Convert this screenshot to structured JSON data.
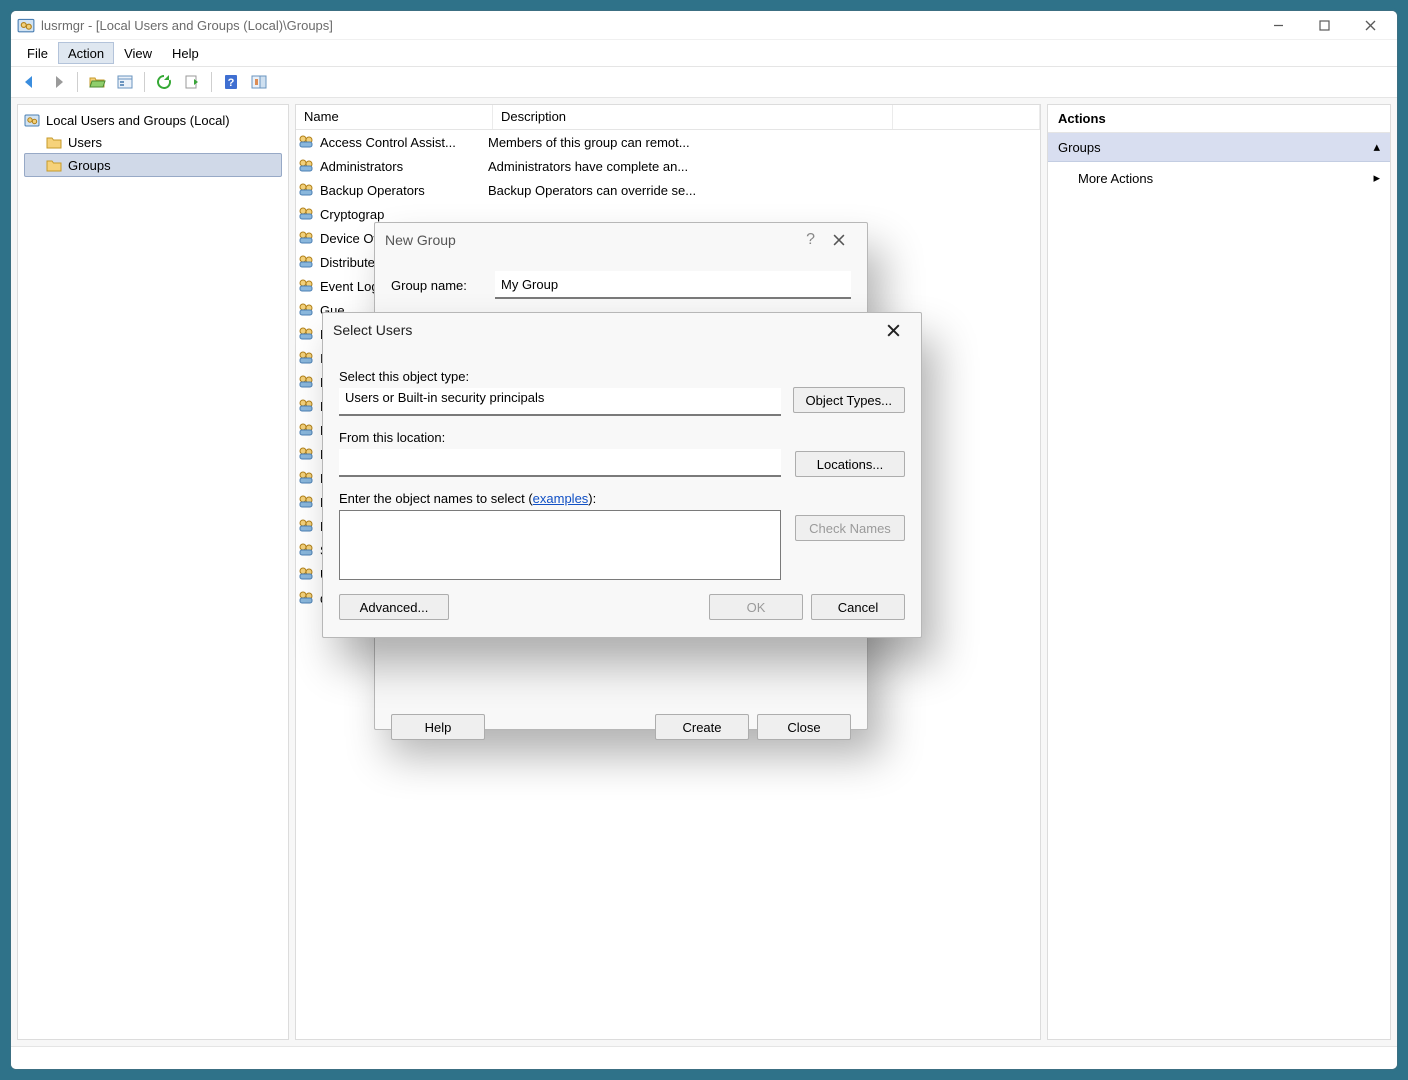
{
  "window": {
    "title": "lusrmgr - [Local Users and Groups (Local)\\Groups]"
  },
  "menus": [
    "File",
    "Action",
    "View",
    "Help"
  ],
  "active_menu_index": 1,
  "tree": {
    "root": "Local Users and Groups (Local)",
    "children": [
      "Users",
      "Groups"
    ],
    "selected_index": 1
  },
  "list": {
    "columns": [
      "Name",
      "Description"
    ],
    "rows": [
      {
        "name": "Access Control Assist...",
        "desc": "Members of this group can remot..."
      },
      {
        "name": "Administrators",
        "desc": "Administrators have complete an..."
      },
      {
        "name": "Backup Operators",
        "desc": "Backup Operators can override se..."
      },
      {
        "name": "Cryptograp",
        "desc": ""
      },
      {
        "name": "Device Own",
        "desc": ""
      },
      {
        "name": "Distributed",
        "desc": ""
      },
      {
        "name": "Event Log R",
        "desc": ""
      },
      {
        "name": "Gue",
        "desc": ""
      },
      {
        "name": "Hyp",
        "desc": ""
      },
      {
        "name": "IIS_I",
        "desc": ""
      },
      {
        "name": "Netv",
        "desc": ""
      },
      {
        "name": "Perf",
        "desc": ""
      },
      {
        "name": "Perf",
        "desc": ""
      },
      {
        "name": "Pow",
        "desc": ""
      },
      {
        "name": "Rem",
        "desc": ""
      },
      {
        "name": "Rem",
        "desc": ""
      },
      {
        "name": "Repl",
        "desc": ""
      },
      {
        "name": "Syst",
        "desc": ""
      },
      {
        "name": "User",
        "desc": ""
      },
      {
        "name": "dock",
        "desc": ""
      }
    ]
  },
  "actions": {
    "title": "Actions",
    "section": "Groups",
    "items": [
      "More Actions"
    ]
  },
  "new_group": {
    "title": "New Group",
    "group_name_label": "Group name:",
    "group_name_value": "My Group",
    "help_btn": "Help",
    "create_btn": "Create",
    "close_btn": "Close"
  },
  "select_users": {
    "title": "Select Users",
    "object_type_label": "Select this object type:",
    "object_type_value": "Users or Built-in security principals",
    "object_types_btn": "Object Types...",
    "location_label": "From this location:",
    "location_value": "",
    "locations_btn": "Locations...",
    "names_label_pre": "Enter the object names to select (",
    "names_link": "examples",
    "names_label_post": "):",
    "names_value": "",
    "check_names_btn": "Check Names",
    "advanced_btn": "Advanced...",
    "ok_btn": "OK",
    "cancel_btn": "Cancel"
  }
}
